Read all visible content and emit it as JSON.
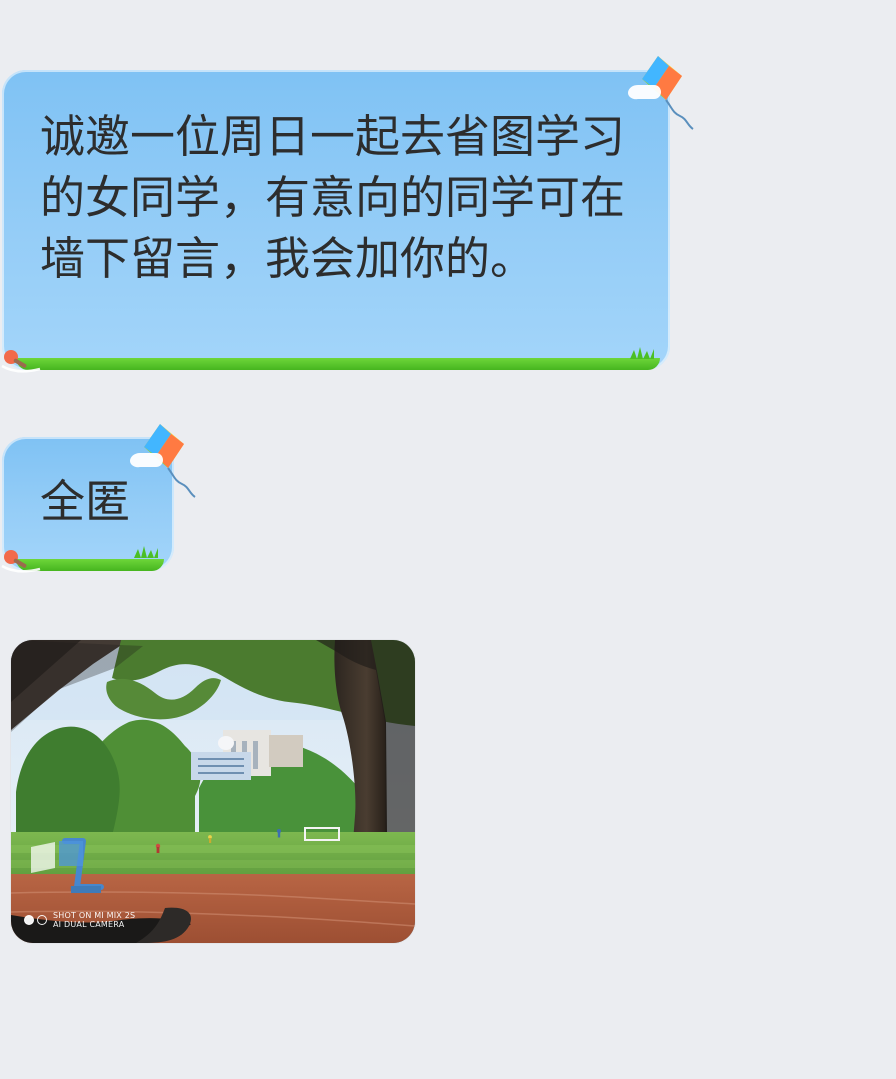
{
  "messages": [
    {
      "text": "诚邀一位周日一起去省图学习的女同学，有意向的同学可在墙下留言，我会加你的。"
    },
    {
      "text": "全匿"
    }
  ],
  "photo": {
    "watermark_line1": "SHOT ON MI MIX 2S",
    "watermark_line2": "AI DUAL CAMERA"
  },
  "icons": {
    "kite": "kite-icon",
    "pin": "pin-icon",
    "grass": "grass-icon",
    "camera_dots": "dual-camera-icon"
  },
  "colors": {
    "background": "#ebedf1",
    "bubble_blue": "#95cdf7",
    "grass_green": "#46b51f",
    "text": "#2d2d2d"
  }
}
